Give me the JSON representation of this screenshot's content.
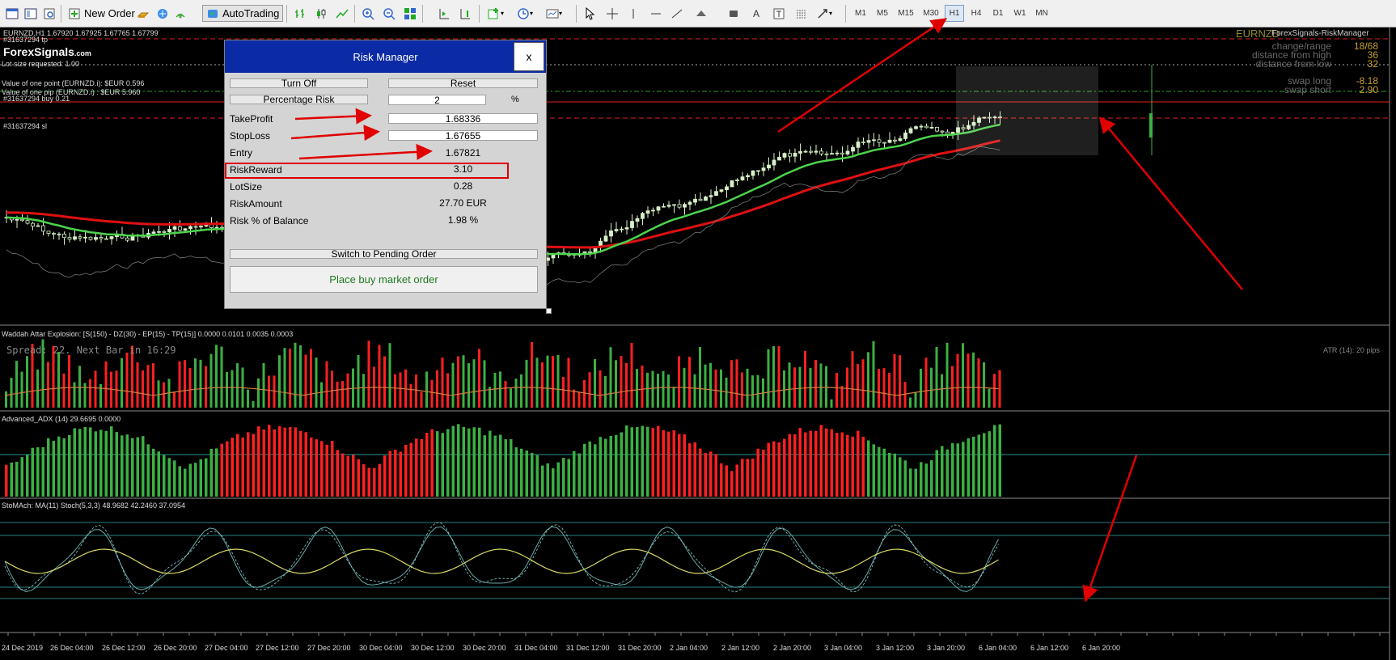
{
  "toolbar": {
    "new_order": "New Order",
    "autotrading": "AutoTrading",
    "timeframes": [
      "M1",
      "M5",
      "M15",
      "M30",
      "H1",
      "H4",
      "D1",
      "W1",
      "MN"
    ],
    "active_timeframe": "H1",
    "icons": [
      "new-chart-icon",
      "profiles-icon",
      "market-watch-icon",
      "navigator-icon",
      "metaeditor-icon",
      "gold-bars-icon",
      "signals-icon",
      "bar-chart-icon",
      "candlestick-icon",
      "line-chart-icon",
      "zoom-in-icon",
      "zoom-out-icon",
      "tile-windows-icon",
      "autoscroll-icon",
      "chart-shift-icon",
      "indicators-icon",
      "periods-icon",
      "templates-icon",
      "cursor-icon",
      "crosshair-icon",
      "vertical-line-icon",
      "horizontal-line-icon",
      "trendline-icon",
      "channel-icon",
      "fibonacci-icon",
      "text-icon",
      "text-label-icon",
      "shapes-icon",
      "arrows-icon"
    ]
  },
  "chart": {
    "header": "EURNZD,H1  1.67920 1.67925 1.67765 1.67799",
    "order_tp": "#31637294 tp",
    "order_sl": "#31637294 sl",
    "order_buy": "#31637294 buy 0.21",
    "logo": "ForexSignals",
    "logo_suffix": ".com",
    "lot_size_text": "Lot size requested: 1.00",
    "point_value_text": "Value of one point (EURNZD.i):  $EUR 0.596",
    "pip_value_text": "Value of one pip   (EURNZD.i) : $EUR 5.960",
    "spread_text": "Spread: 22. Next Bar in 16:29",
    "atr_text": "ATR (14): 20 pips",
    "symbol_watermark": "EURNZD",
    "ea_name": "ForexSignals-RiskManager",
    "stats": [
      {
        "label": "change/range",
        "value": "18/68"
      },
      {
        "label": "distance from high",
        "value": "36"
      },
      {
        "label": "distance from low",
        "value": "32"
      },
      {
        "label": "swap long",
        "value": "-8.18"
      },
      {
        "label": "swap short",
        "value": "2.90"
      }
    ],
    "colors": {
      "bull": "#3cb043",
      "bear": "#ff2020",
      "ma_green": "#4cd44c",
      "ma_red": "#e01010",
      "stoch_main": "#d8d860"
    }
  },
  "dialog": {
    "title": "Risk Manager",
    "close": "x",
    "turn_off": "Turn Off",
    "reset": "Reset",
    "percentage_risk_label": "Percentage Risk",
    "percentage_risk_value": "2",
    "percent_symbol": "%",
    "take_profit_label": "TakeProfit",
    "take_profit_value": "1.68336",
    "stop_loss_label": "StopLoss",
    "stop_loss_value": "1.67655",
    "entry_label": "Entry",
    "entry_value": "1.67821",
    "risk_reward_label": "RiskReward",
    "risk_reward_value": "3.10",
    "lot_size_label": "LotSize",
    "lot_size_value": "0.28",
    "risk_amount_label": "RiskAmount",
    "risk_amount_value": "27.70 EUR",
    "risk_balance_label": "Risk % of Balance",
    "risk_balance_value": "1.98 %",
    "switch_pending": "Switch to Pending Order",
    "place_order": "Place buy market order"
  },
  "indicators": {
    "waddah_title": "Waddah Attar Explosion: [S(150) - DZ(30) - EP(15) - TP(15)] 0.0000 0.0101 0.0035 0.0003",
    "adx_title": "Advanced_ADX (14) 29.6695 0.0000",
    "stoch_title": "StoMAch: MA(11)  Stoch(5,3,3) 48.9682 42.2460 37.0954"
  },
  "time_axis": [
    "24 Dec 2019",
    "26 Dec 04:00",
    "26 Dec 12:00",
    "26 Dec 20:00",
    "27 Dec 04:00",
    "27 Dec 12:00",
    "27 Dec 20:00",
    "30 Dec 04:00",
    "30 Dec 12:00",
    "30 Dec 20:00",
    "31 Dec 04:00",
    "31 Dec 12:00",
    "31 Dec 20:00",
    "2 Jan 04:00",
    "2 Jan 12:00",
    "2 Jan 20:00",
    "3 Jan 04:00",
    "3 Jan 12:00",
    "3 Jan 20:00",
    "6 Jan 04:00",
    "6 Jan 12:00",
    "6 Jan 20:00"
  ]
}
